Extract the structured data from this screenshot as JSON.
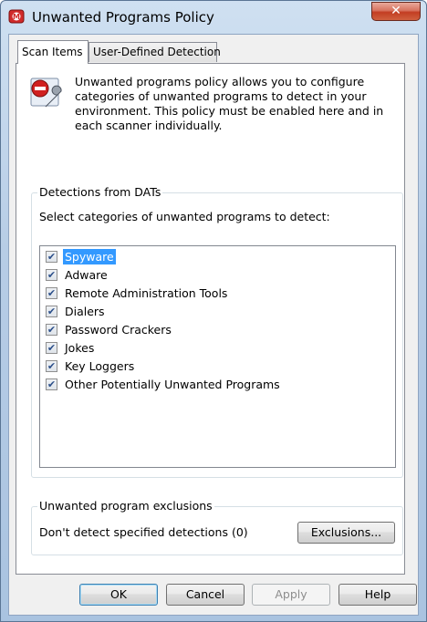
{
  "window": {
    "title": "Unwanted Programs Policy",
    "close_label": "✕"
  },
  "tabs": [
    {
      "label": "Scan Items",
      "active": true
    },
    {
      "label": "User-Defined Detection",
      "active": false
    }
  ],
  "description": "Unwanted programs policy allows you to configure categories of unwanted programs to detect in your environment.  This policy must be enabled here and in each scanner individually.",
  "detections": {
    "group_label": "Detections from DATs",
    "instruction": "Select categories of unwanted programs to detect:",
    "items": [
      {
        "label": "Spyware",
        "checked": true,
        "selected": true
      },
      {
        "label": "Adware",
        "checked": true,
        "selected": false
      },
      {
        "label": "Remote Administration Tools",
        "checked": true,
        "selected": false
      },
      {
        "label": "Dialers",
        "checked": true,
        "selected": false
      },
      {
        "label": "Password Crackers",
        "checked": true,
        "selected": false
      },
      {
        "label": "Jokes",
        "checked": true,
        "selected": false
      },
      {
        "label": "Key Loggers",
        "checked": true,
        "selected": false
      },
      {
        "label": "Other Potentially Unwanted Programs",
        "checked": true,
        "selected": false
      }
    ]
  },
  "exclusions": {
    "group_label": "Unwanted program exclusions",
    "text": "Don't detect specified detections (0)",
    "button_label": "Exclusions..."
  },
  "buttons": {
    "ok": "OK",
    "cancel": "Cancel",
    "apply": "Apply",
    "help": "Help"
  },
  "colors": {
    "selection": "#3399ff",
    "title_bar": "#b7cde6",
    "close_button": "#c23d22"
  },
  "icons": {
    "app": "antivirus-shield-icon",
    "info": "policy-wrench-icon",
    "check": "checkmark-icon"
  }
}
